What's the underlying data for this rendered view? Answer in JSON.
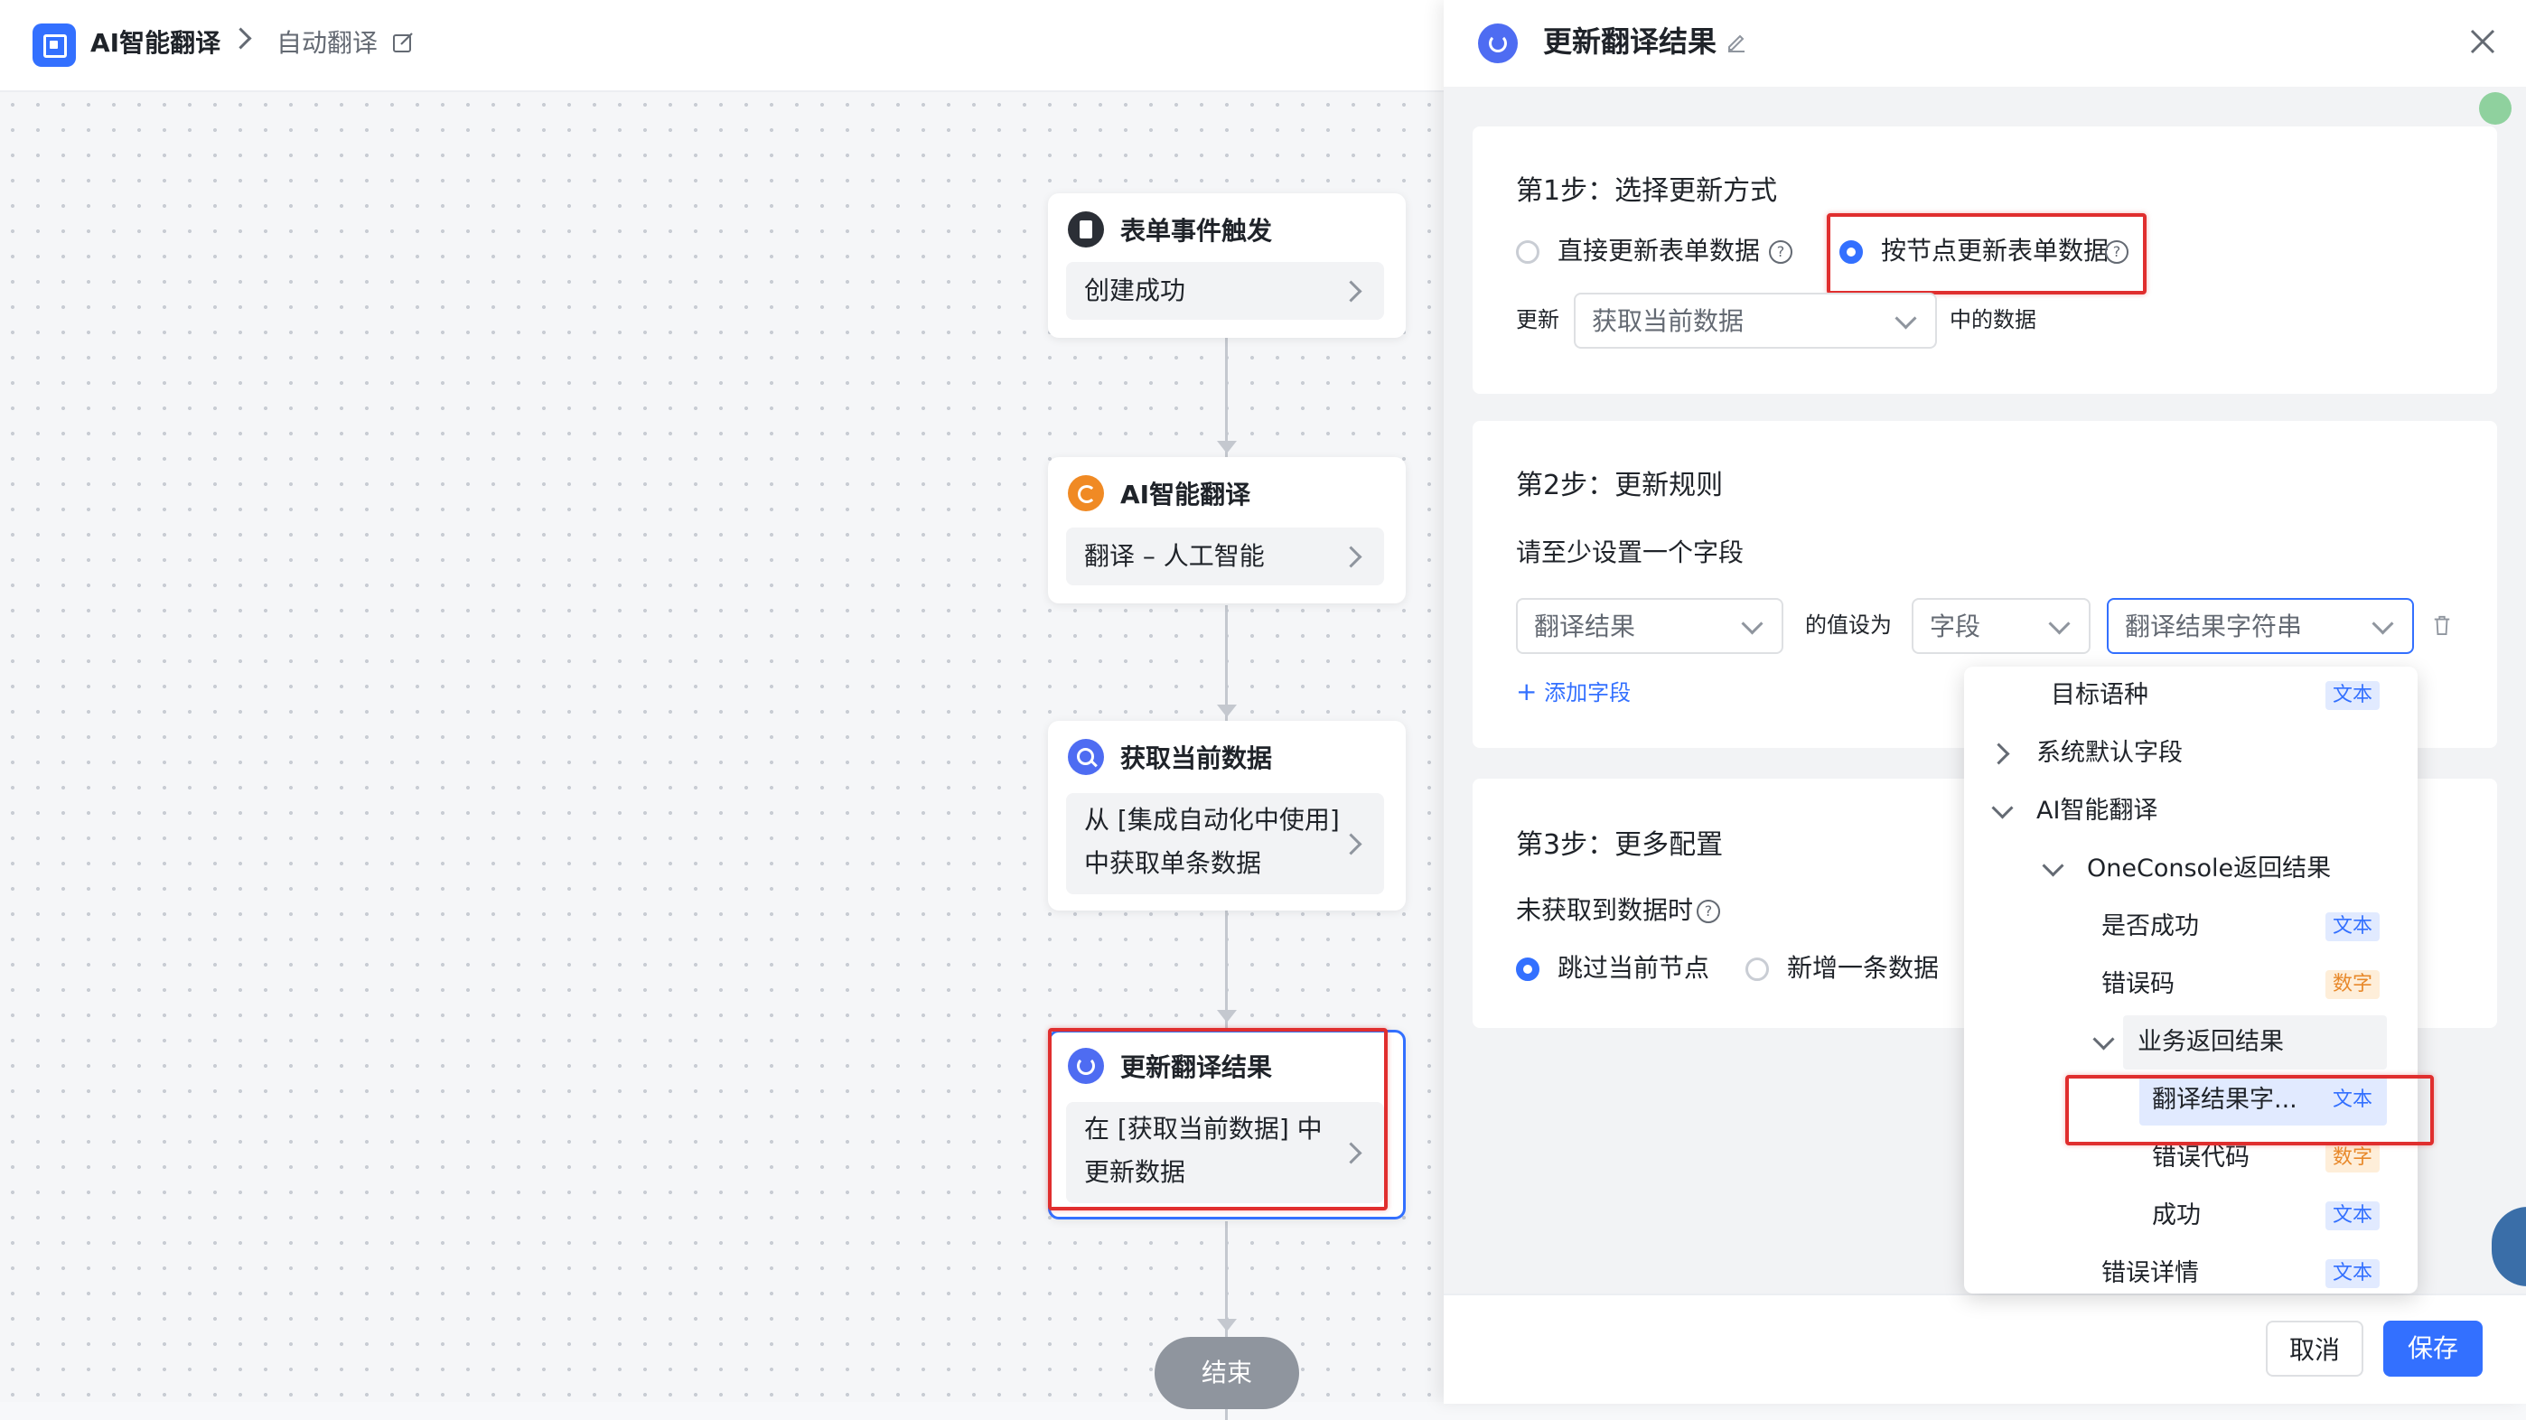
{
  "header": {
    "app_name": "AI智能翻译",
    "breadcrumb_current": "自动翻译"
  },
  "flow": {
    "nodes": [
      {
        "title": "表单事件触发",
        "body": "创建成功",
        "icon": "document-icon"
      },
      {
        "title": "AI智能翻译",
        "body": "翻译 – 人工智能",
        "icon": "ai-translate-icon"
      },
      {
        "title": "获取当前数据",
        "body_line1": "从 [集成自动化中使用]",
        "body_line2": "中获取单条数据",
        "icon": "search-icon"
      },
      {
        "title": "更新翻译结果",
        "body_line1": "在 [获取当前数据] 中",
        "body_line2": "更新数据",
        "icon": "refresh-icon"
      }
    ],
    "end_label": "结束"
  },
  "panel": {
    "title": "更新翻译结果",
    "step1": {
      "title": "第1步：选择更新方式",
      "option_direct": "直接更新表单数据",
      "option_by_node": "按节点更新表单数据",
      "selected": "option_by_node",
      "update_prefix": "更新",
      "source_select": "获取当前数据",
      "update_suffix": "中的数据"
    },
    "step2": {
      "title": "第2步：更新规则",
      "hint": "请至少设置一个字段",
      "field_select": "翻译结果",
      "set_to": "的值设为",
      "type_select": "字段",
      "value_select": "翻译结果字符串",
      "add_field": "添加字段"
    },
    "step3": {
      "title": "第3步：更多配置",
      "when_missing": "未获取到数据时",
      "option_skip": "跳过当前节点",
      "option_add": "新增一条数据",
      "selected": "option_skip"
    },
    "cancel": "取消",
    "save": "保存"
  },
  "dropdown": {
    "items": [
      {
        "label": "目标语种",
        "tag": "文本"
      },
      {
        "label": "系统默认字段",
        "tree": "collapsed"
      },
      {
        "label": "AI智能翻译",
        "tree": "expanded"
      },
      {
        "label": "OneConsole返回结果",
        "tree": "expanded"
      },
      {
        "label": "是否成功",
        "tag": "文本"
      },
      {
        "label": "错误码",
        "tag": "数字"
      },
      {
        "label": "业务返回结果",
        "tree": "expanded"
      },
      {
        "label": "翻译结果字...",
        "tag": "文本",
        "selected": true
      },
      {
        "label": "错误代码",
        "tag": "数字"
      },
      {
        "label": "成功",
        "tag": "文本"
      },
      {
        "label": "错误详情",
        "tag": "文本"
      }
    ]
  },
  "colors": {
    "accent": "#3370ff",
    "highlight_box": "#e02e2e",
    "tag_text_bg": "#e1eaff",
    "tag_num_bg": "#feeed9"
  }
}
